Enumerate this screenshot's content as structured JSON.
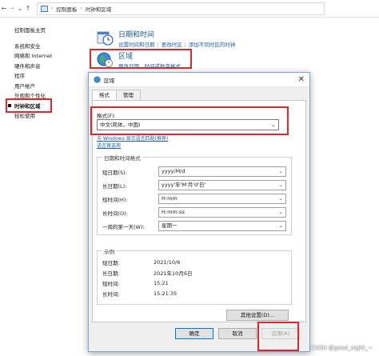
{
  "address_bar": {
    "path": [
      "控制面板",
      "时钟和区域"
    ]
  },
  "sidebar": {
    "home": "控制面板主页",
    "items": [
      {
        "label": "系统和安全"
      },
      {
        "label": "网络和 Internet"
      },
      {
        "label": "硬件和声音"
      },
      {
        "label": "程序"
      },
      {
        "label": "用户帐户"
      },
      {
        "label": "外观和个性化"
      },
      {
        "label": "时钟和区域",
        "current": true
      },
      {
        "label": "轻松使用"
      }
    ]
  },
  "sections": {
    "datetime": {
      "title": "日期和时间",
      "links": [
        "设置时间和日期",
        "更改时区",
        "添加不同时区的时钟"
      ]
    },
    "region": {
      "title": "区域",
      "links": [
        "更改日期、时间或数字格式"
      ]
    }
  },
  "dialog": {
    "title": "区域",
    "tabs": [
      "格式",
      "管理"
    ],
    "format_label": "格式(F):",
    "format_value": "中文(简体，中国)",
    "link_match": "与 Windows 显示语言匹配(推荐)",
    "link_language": "语言首选项",
    "datetime_group": {
      "title": "日期和时间格式",
      "rows": [
        {
          "label": "短日期(S):",
          "value": "yyyy/M/d"
        },
        {
          "label": "长日期(L):",
          "value": "yyyy'年'M'月'd'日'"
        },
        {
          "label": "短时间(H):",
          "value": "H:mm"
        },
        {
          "label": "长时间(O):",
          "value": "H:mm:ss"
        },
        {
          "label": "一周的第一天(W):",
          "value": "星期一"
        }
      ]
    },
    "examples_group": {
      "title": "示例",
      "rows": [
        {
          "label": "短日期:",
          "value": "2021/10/6"
        },
        {
          "label": "长日期:",
          "value": "2021年10月6日"
        },
        {
          "label": "短时间:",
          "value": "15:21"
        },
        {
          "label": "长时间:",
          "value": "15:21:35"
        }
      ]
    },
    "buttons": {
      "other_settings": "其他设置(D)...",
      "ok": "确定",
      "cancel": "取消",
      "apply": "应用(A)"
    }
  },
  "watermark": "CSDN @good_night_~",
  "colors": {
    "highlight_box": "#e8232a",
    "link": "#1c5fb0",
    "section_title": "#1e5a8e"
  }
}
